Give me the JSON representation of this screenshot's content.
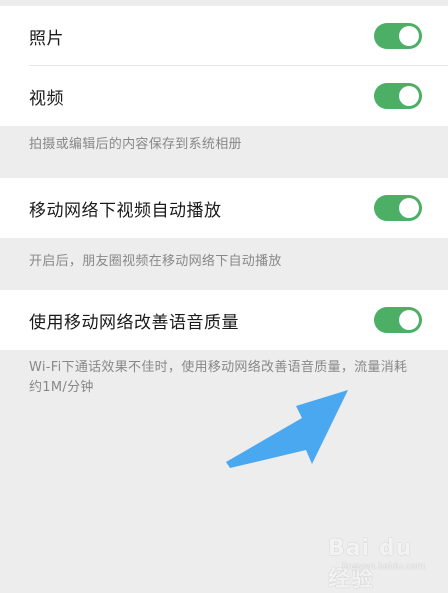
{
  "settings": {
    "group1": {
      "items": [
        {
          "label": "照片",
          "enabled": true
        },
        {
          "label": "视频",
          "enabled": true
        }
      ],
      "hint": "拍摄或编辑后的内容保存到系统相册"
    },
    "group2": {
      "item": {
        "label": "移动网络下视频自动播放",
        "enabled": true
      },
      "hint": "开启后，朋友圈视频在移动网络下自动播放"
    },
    "group3": {
      "item": {
        "label": "使用移动网络改善语音质量",
        "enabled": true
      },
      "hint": "Wi-Fi下通话效果不佳时，使用移动网络改善语音质量，流量消耗约1M/分钟"
    }
  },
  "toggle_color": "#4caf65",
  "annotation": {
    "arrow_color": "#4aa8f0",
    "arrow_icon": "arrow-up-right-icon"
  },
  "watermark": {
    "text": "Bai du 经验",
    "sub": "jingyan.baidu.com"
  }
}
